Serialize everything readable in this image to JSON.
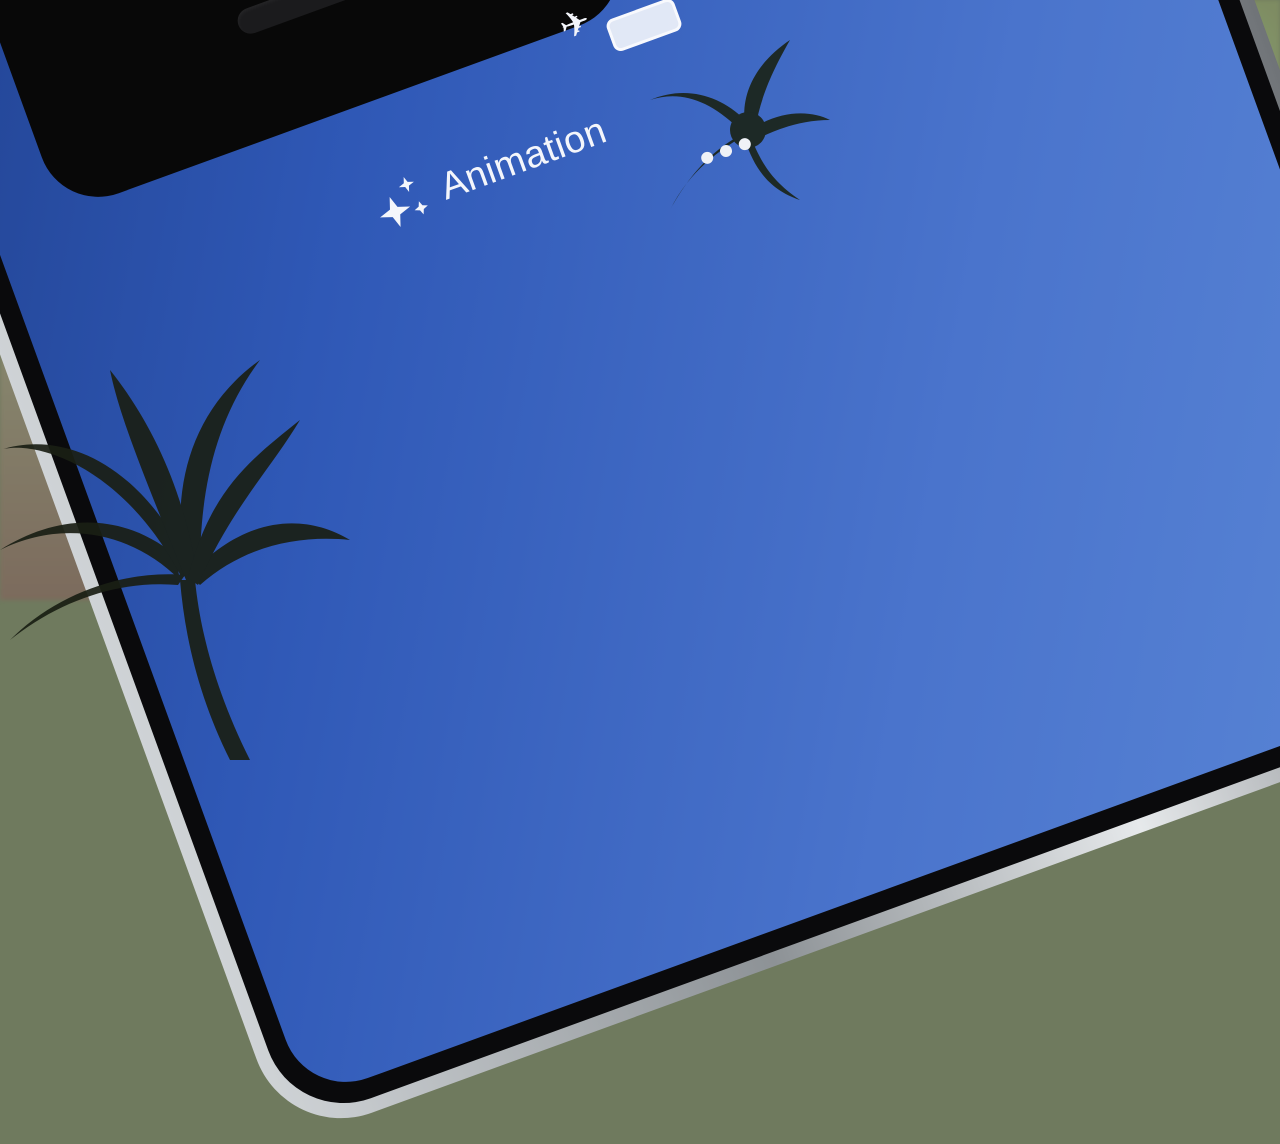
{
  "status_bar": {
    "airplane_icon": "airplane-icon",
    "battery_icon": "battery-icon"
  },
  "effect_label": {
    "icon": "sparkles-icon",
    "text": "Animation"
  },
  "more_menu": {
    "icon": "more-dots-icon"
  },
  "colors": {
    "screen_blue": "#2f58b6",
    "label_white": "#f4f6fb"
  }
}
